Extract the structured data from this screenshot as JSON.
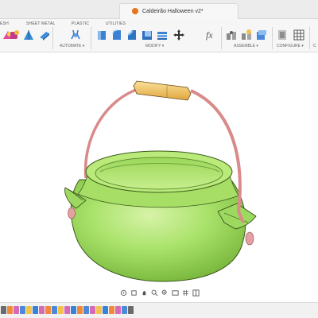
{
  "window": {
    "doc_title": "Caldeirão Halloween v2*"
  },
  "toolbar": {
    "tabs": {
      "mesh": "ESH",
      "sheet_metal": "SHEET METAL",
      "plastic": "PLASTIC",
      "utilities": "UTILITIES"
    },
    "groups": {
      "automate": "AUTOMATE ▾",
      "modify": "MODIFY ▾",
      "assemble": "ASSEMBLE ▾",
      "configure": "CONFIGURE ▾",
      "truncated": "C"
    }
  },
  "icons": {
    "mesh": "mesh-icon",
    "sheet_metal": "sheet-metal-icon",
    "automate": "automate-icon",
    "modify": [
      "press-pull-icon",
      "fillet-icon",
      "chamfer-icon",
      "shell-icon",
      "scale-icon",
      "move-icon",
      "fx-parameters-icon"
    ],
    "assemble": [
      "joint-icon",
      "as-built-joint-icon",
      "component-icon"
    ],
    "configure": [
      "configure-icon",
      "table-icon"
    ]
  },
  "model": {
    "pot_color": "#a9e26a",
    "pot_shade": "#7fc23d",
    "handle_color": "#d98a8a",
    "grip_color": "#f2c56a"
  },
  "colors": {
    "accent_blue": "#1f73c9",
    "tab_orange": "#e8731a"
  }
}
